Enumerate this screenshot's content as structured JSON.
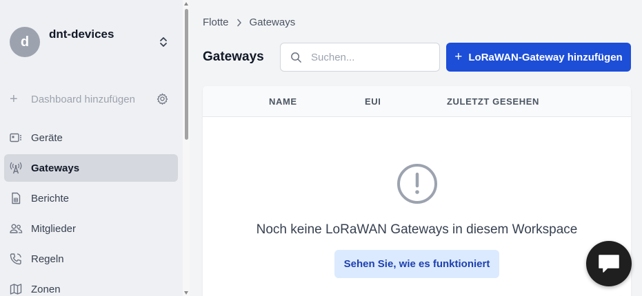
{
  "workspace": {
    "avatar_letter": "d",
    "name": "dnt-devices"
  },
  "sidebar": {
    "add_dashboard": "Dashboard hinzufügen",
    "items": [
      {
        "label": "Geräte",
        "icon": "device-icon",
        "active": false
      },
      {
        "label": "Gateways",
        "icon": "gateway-icon",
        "active": true
      },
      {
        "label": "Berichte",
        "icon": "report-icon",
        "active": false
      },
      {
        "label": "Mitglieder",
        "icon": "members-icon",
        "active": false
      },
      {
        "label": "Regeln",
        "icon": "rules-icon",
        "active": false
      },
      {
        "label": "Zonen",
        "icon": "map-icon",
        "active": false
      }
    ]
  },
  "breadcrumb": {
    "parent": "Flotte",
    "current": "Gateways"
  },
  "page": {
    "title": "Gateways"
  },
  "search": {
    "placeholder": "Suchen..."
  },
  "actions": {
    "add_gateway": "LoRaWAN-Gateway hinzufügen"
  },
  "table": {
    "columns": [
      "NAME",
      "EUI",
      "ZULETZT GESEHEN"
    ],
    "empty_message": "Noch keine LoRaWAN Gateways in diesem Workspace",
    "help_button": "Sehen Sie, wie es funktioniert"
  },
  "colors": {
    "primary": "#1d4ed8",
    "primary_light": "#dbeafe",
    "sidebar_active": "#d5d8de",
    "chat_fab": "#1f1f1f"
  }
}
